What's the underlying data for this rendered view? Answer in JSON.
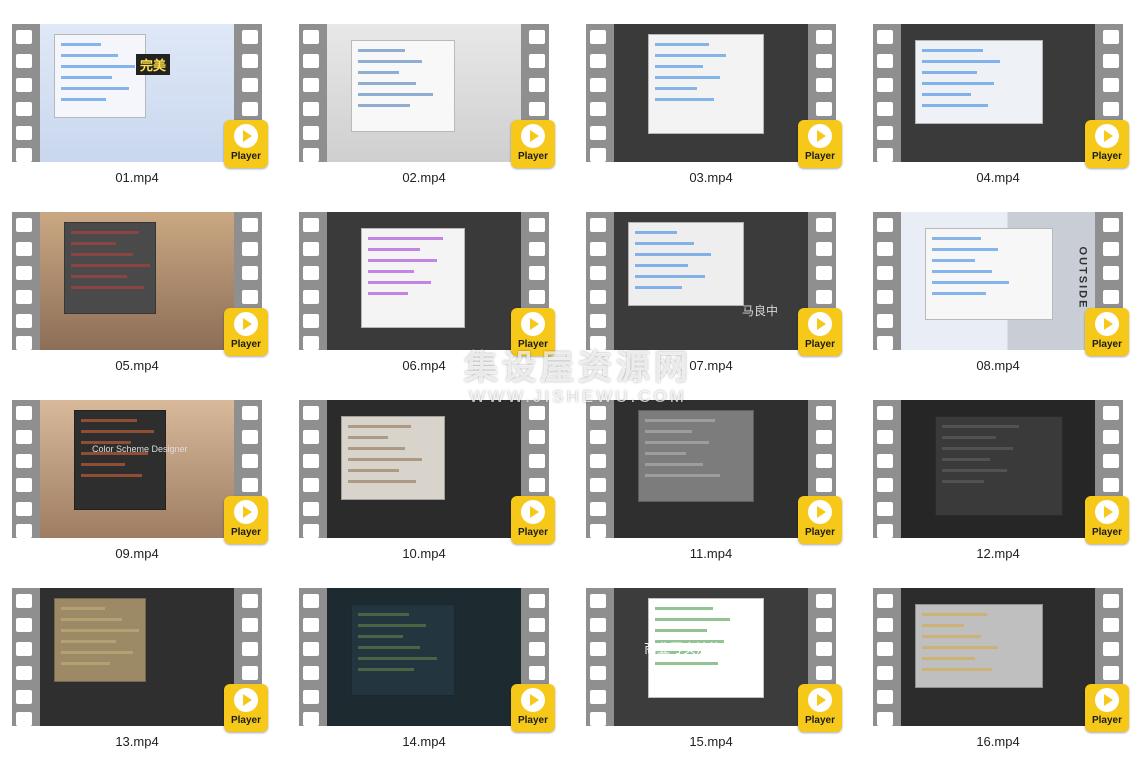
{
  "player_label": "Player",
  "videos": [
    {
      "file": "01.mp4",
      "thumb_text": "完美"
    },
    {
      "file": "02.mp4",
      "thumb_text": ""
    },
    {
      "file": "03.mp4",
      "thumb_text": ""
    },
    {
      "file": "04.mp4",
      "thumb_text": ""
    },
    {
      "file": "05.mp4",
      "thumb_text": ""
    },
    {
      "file": "06.mp4",
      "thumb_text": ""
    },
    {
      "file": "07.mp4",
      "thumb_text": "马良中"
    },
    {
      "file": "08.mp4",
      "thumb_text": "OUTSIDE"
    },
    {
      "file": "09.mp4",
      "thumb_text": "Color Scheme Designer"
    },
    {
      "file": "10.mp4",
      "thumb_text": ""
    },
    {
      "file": "11.mp4",
      "thumb_text": ""
    },
    {
      "file": "12.mp4",
      "thumb_text": ""
    },
    {
      "file": "13.mp4",
      "thumb_text": ""
    },
    {
      "file": "14.mp4",
      "thumb_text": ""
    },
    {
      "file": "15.mp4",
      "thumb_text": "商业写实渲染"
    },
    {
      "file": "16.mp4",
      "thumb_text": ""
    }
  ],
  "watermark": {
    "line1": "集设屋资源网",
    "line2": "WWW.JISHEWU.COM"
  }
}
